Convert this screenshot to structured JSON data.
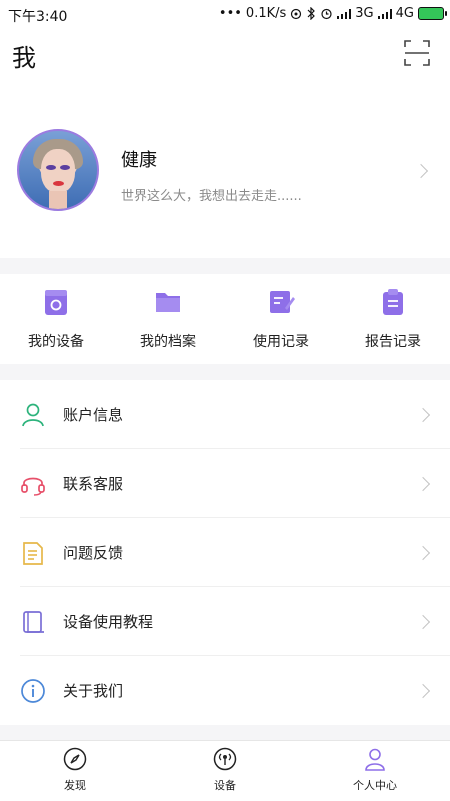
{
  "statusbar": {
    "time": "下午3:40",
    "dots": "•••",
    "speed": "0.1K/s",
    "network1": "3G",
    "network2": "4G"
  },
  "header": {
    "title": "我",
    "scan_icon": "scan-icon"
  },
  "profile": {
    "name": "健康",
    "motto": "世界这么大，我想出去走走......"
  },
  "quick_actions": [
    {
      "label": "我的设备",
      "icon": "device-icon"
    },
    {
      "label": "我的档案",
      "icon": "folder-icon"
    },
    {
      "label": "使用记录",
      "icon": "edit-record-icon"
    },
    {
      "label": "报告记录",
      "icon": "clipboard-icon"
    }
  ],
  "menu": [
    {
      "label": "账户信息",
      "icon": "user-icon",
      "color": "#2db37c"
    },
    {
      "label": "联系客服",
      "icon": "headset-icon",
      "color": "#e7506a"
    },
    {
      "label": "问题反馈",
      "icon": "feedback-icon",
      "color": "#e6b84a"
    },
    {
      "label": "设备使用教程",
      "icon": "book-icon",
      "color": "#7a6fd6"
    },
    {
      "label": "关于我们",
      "icon": "info-icon",
      "color": "#4c88d8"
    }
  ],
  "bottom_nav": [
    {
      "label": "发现",
      "icon": "compass-icon"
    },
    {
      "label": "设备",
      "icon": "device-signal-icon"
    },
    {
      "label": "个人中心",
      "icon": "person-icon"
    }
  ],
  "colors": {
    "accent": "#8e6fe8",
    "chevron": "#c4c4c4"
  }
}
